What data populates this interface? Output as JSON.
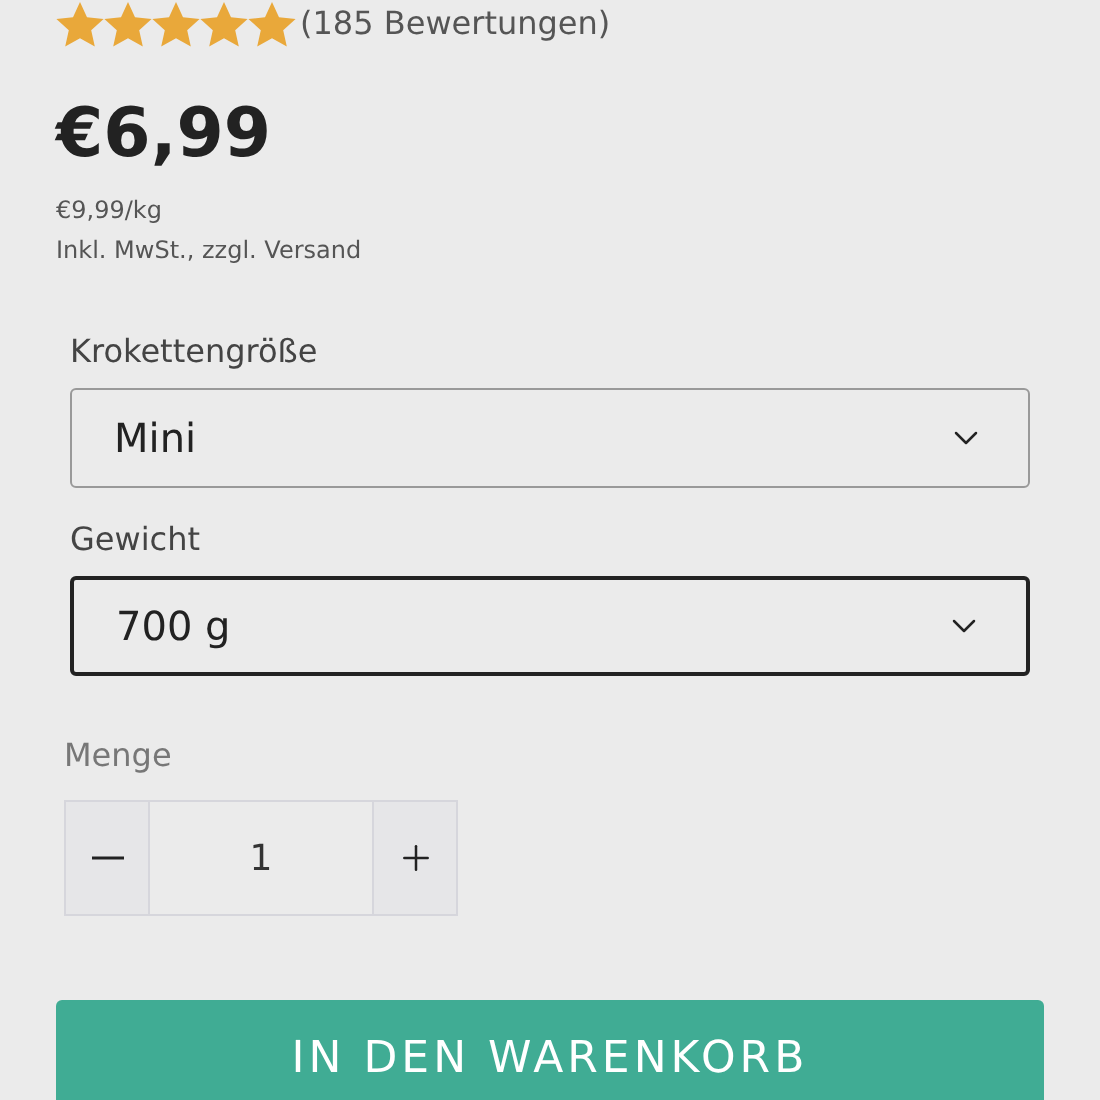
{
  "rating": {
    "stars": 5,
    "count": "(185 Bewertungen)"
  },
  "price": {
    "amount": "€6,99",
    "unit_price": "€9,99/kg",
    "tax_note": "Inkl. MwSt., zzgl. Versand"
  },
  "selects": [
    {
      "label": "Krokettengröße",
      "value": "Mini",
      "focused": false
    },
    {
      "label": "Gewicht",
      "value": "700 g",
      "focused": true
    }
  ],
  "quantity": {
    "label": "Menge",
    "value": "1"
  },
  "add_to_cart": "IN DEN WARENKORB"
}
